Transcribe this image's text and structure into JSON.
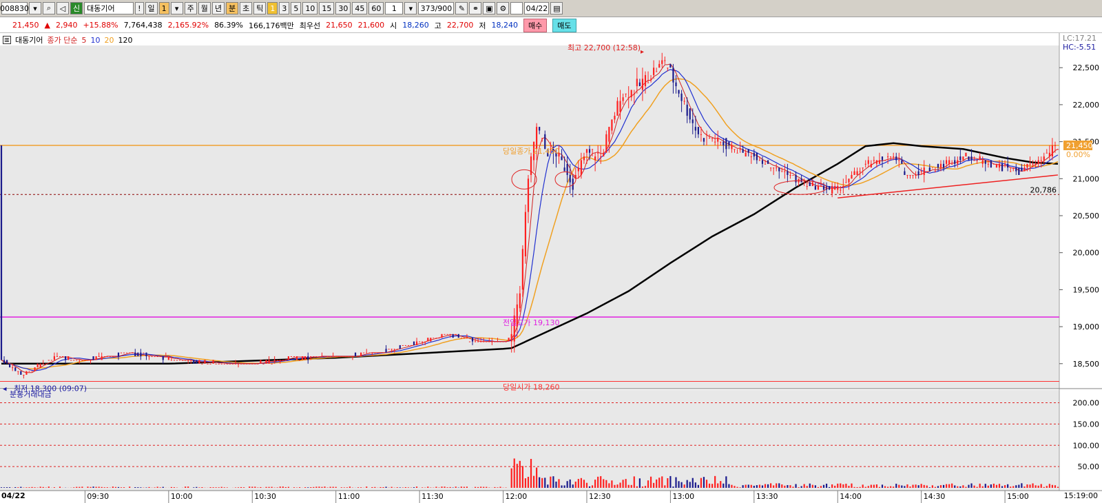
{
  "toolbar": {
    "code": "008830",
    "stock_name": "대동기어",
    "period_buttons": [
      "!",
      "일",
      "1",
      "주",
      "월",
      "년",
      "분",
      "초",
      "틱",
      "1",
      "3",
      "5",
      "10",
      "15",
      "30",
      "45",
      "60"
    ],
    "count_value": "1",
    "bar_count": "373/900",
    "date": "04/22",
    "new_label": "신"
  },
  "quote": {
    "price": "21,450",
    "change": "2,940",
    "change_pct": "+15.88%",
    "volume": "7,764,438",
    "vol_ratio": "2,165.92%",
    "rate2": "86.39%",
    "amount": "166,176백만",
    "best_label": "최우선",
    "best_ask": "21,650",
    "best_bid": "21,600",
    "open_label": "시",
    "open": "18,260",
    "high_label": "고",
    "high": "22,700",
    "low_label": "저",
    "low": "18,240",
    "buy_label": "매수",
    "sell_label": "매도"
  },
  "legend": {
    "name": "대동기어",
    "ma_label": "종가 단순",
    "ma5": "5",
    "ma10": "10",
    "ma20": "20",
    "ma120": "120"
  },
  "right_top": {
    "lc": "LC:17.21",
    "hc": "HC:-5.51"
  },
  "colors": {
    "ma5": "#d02020",
    "ma10": "#2030d0",
    "ma20": "#f0a020",
    "ma120": "#000000",
    "up": "#ff2020",
    "down": "#1a1a8c",
    "close_line": "#f0a030",
    "prev_high": "#e020e0",
    "open_line": "#ff3030",
    "support": "#8b0000",
    "trend": "#ee2020"
  },
  "annotations": {
    "high": "최고 22,700 (12:58)",
    "low": "최저 18,300 (09:07)",
    "close_label": "당일종가 21,450",
    "close_pct": "0.00%",
    "prev_high": "전일고가 19,130",
    "open_label": "당일시가 18,260",
    "support_value": "20,786",
    "current_price": "21,450"
  },
  "volume_panel": {
    "title": "분봉거래대금",
    "ticks": [
      "200.00",
      "150.00",
      "100.00",
      "50.00"
    ]
  },
  "x_axis": {
    "date": "04/22",
    "end": "15:19:00",
    "ticks": [
      "09:30",
      "10:00",
      "10:30",
      "11:00",
      "11:30",
      "12:00",
      "12:30",
      "13:00",
      "13:30",
      "14:00",
      "14:30",
      "15:00"
    ]
  },
  "chart_data": {
    "type": "candlestick",
    "ylim": [
      18200,
      22800
    ],
    "y_ticks": [
      "22,500",
      "22,000",
      "21,500",
      "21,000",
      "20,500",
      "20,000",
      "19,500",
      "19,000",
      "18,500"
    ],
    "y_tick_values": [
      22500,
      22000,
      21500,
      21000,
      20500,
      20000,
      19500,
      19000,
      18500
    ],
    "reference_lines": {
      "close": 21450,
      "prev_high": 19130,
      "open": 18260,
      "support": 20786
    },
    "keypoints": [
      [
        "09:00",
        18550
      ],
      [
        "09:07",
        18350
      ],
      [
        "09:20",
        18600
      ],
      [
        "09:30",
        18550
      ],
      [
        "09:45",
        18650
      ],
      [
        "09:55",
        18600
      ],
      [
        "10:10",
        18520
      ],
      [
        "10:30",
        18500
      ],
      [
        "10:45",
        18580
      ],
      [
        "11:00",
        18600
      ],
      [
        "11:15",
        18650
      ],
      [
        "11:30",
        18800
      ],
      [
        "11:40",
        18900
      ],
      [
        "11:50",
        18800
      ],
      [
        "12:00",
        18800
      ],
      [
        "12:03",
        18850
      ],
      [
        "12:06",
        19500
      ],
      [
        "12:09",
        21000
      ],
      [
        "12:12",
        21700
      ],
      [
        "12:15",
        21400
      ],
      [
        "12:20",
        21300
      ],
      [
        "12:25",
        20950
      ],
      [
        "12:30",
        21350
      ],
      [
        "12:35",
        21300
      ],
      [
        "12:42",
        22100
      ],
      [
        "12:50",
        22300
      ],
      [
        "12:58",
        22600
      ],
      [
        "13:05",
        22000
      ],
      [
        "13:10",
        21600
      ],
      [
        "13:20",
        21450
      ],
      [
        "13:30",
        21300
      ],
      [
        "13:40",
        21100
      ],
      [
        "13:50",
        20900
      ],
      [
        "14:00",
        20850
      ],
      [
        "14:10",
        21200
      ],
      [
        "14:20",
        21300
      ],
      [
        "14:25",
        21050
      ],
      [
        "14:35",
        21150
      ],
      [
        "14:45",
        21300
      ],
      [
        "14:55",
        21200
      ],
      [
        "15:05",
        21100
      ],
      [
        "15:10",
        21200
      ],
      [
        "15:19",
        21450
      ]
    ],
    "ma120": [
      [
        "09:00",
        18500
      ],
      [
        "10:00",
        18500
      ],
      [
        "11:00",
        18580
      ],
      [
        "12:00",
        18700
      ],
      [
        "12:03",
        18710
      ],
      [
        "12:30",
        19180
      ],
      [
        "12:45",
        19480
      ],
      [
        "13:00",
        19860
      ],
      [
        "13:15",
        20220
      ],
      [
        "13:30",
        20520
      ],
      [
        "13:45",
        20880
      ],
      [
        "14:00",
        21200
      ],
      [
        "14:10",
        21440
      ],
      [
        "14:20",
        21480
      ],
      [
        "14:30",
        21440
      ],
      [
        "14:45",
        21400
      ],
      [
        "15:00",
        21280
      ],
      [
        "15:10",
        21220
      ],
      [
        "15:19",
        21200
      ]
    ],
    "trendline": [
      [
        "14:00",
        20740
      ],
      [
        "15:19",
        21050
      ]
    ],
    "volume_ylim": [
      0,
      230
    ],
    "volume_peak": {
      "time": "12:10",
      "value": 68
    }
  }
}
